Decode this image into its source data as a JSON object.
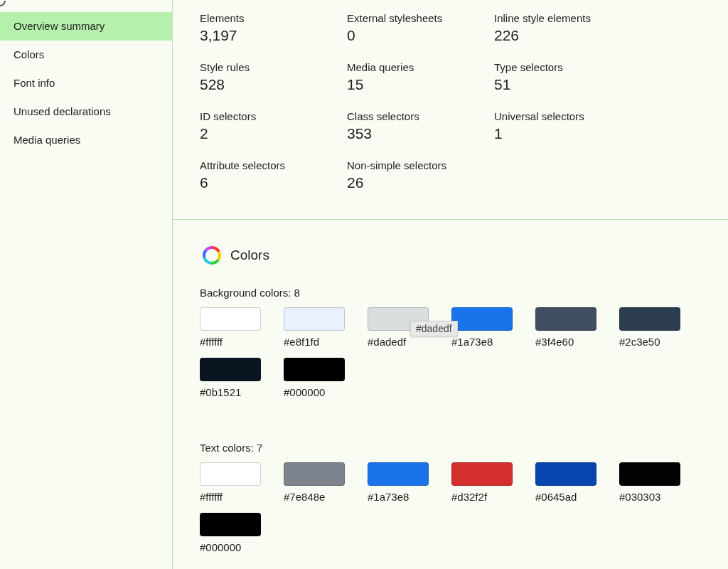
{
  "sidebar": {
    "items": [
      {
        "label": "Overview summary",
        "selected": true
      },
      {
        "label": "Colors",
        "selected": false
      },
      {
        "label": "Font info",
        "selected": false
      },
      {
        "label": "Unused declarations",
        "selected": false
      },
      {
        "label": "Media queries",
        "selected": false
      }
    ]
  },
  "stats": [
    {
      "label": "Elements",
      "value": "3,197"
    },
    {
      "label": "External stylesheets",
      "value": "0"
    },
    {
      "label": "Inline style elements",
      "value": "226"
    },
    {
      "label": "Style rules",
      "value": "528"
    },
    {
      "label": "Media queries",
      "value": "15"
    },
    {
      "label": "Type selectors",
      "value": "51"
    },
    {
      "label": "ID selectors",
      "value": "2"
    },
    {
      "label": "Class selectors",
      "value": "353"
    },
    {
      "label": "Universal selectors",
      "value": "1"
    },
    {
      "label": "Attribute selectors",
      "value": "6"
    },
    {
      "label": "Non-simple selectors",
      "value": "26"
    }
  ],
  "colors_section": {
    "title": "Colors",
    "groups": [
      {
        "heading": "Background colors: 8",
        "swatches": [
          {
            "label": "#ffffff",
            "color": "#ffffff"
          },
          {
            "label": "#e8f1fd",
            "color": "#e8f1fd"
          },
          {
            "label": "#dadedf",
            "color": "#dadedf",
            "tooltip": "#dadedf"
          },
          {
            "label": "#1a73e8",
            "color": "#1a73e8"
          },
          {
            "label": "#3f4e60",
            "color": "#3f4e60"
          },
          {
            "label": "#2c3e50",
            "color": "#2c3e50"
          },
          {
            "label": "#0b1521",
            "color": "#0b1521"
          },
          {
            "label": "#000000",
            "color": "#000000"
          }
        ]
      },
      {
        "heading": "Text colors: 7",
        "swatches": [
          {
            "label": "#ffffff",
            "color": "#ffffff"
          },
          {
            "label": "#7e848e",
            "color": "#7e848e"
          },
          {
            "label": "#1a73e8",
            "color": "#1a73e8"
          },
          {
            "label": "#d32f2f",
            "color": "#d32f2f"
          },
          {
            "label": "#0645ad",
            "color": "#0645ad"
          },
          {
            "label": "#030303",
            "color": "#030303"
          },
          {
            "label": "#000000",
            "color": "#000000"
          }
        ]
      }
    ]
  }
}
